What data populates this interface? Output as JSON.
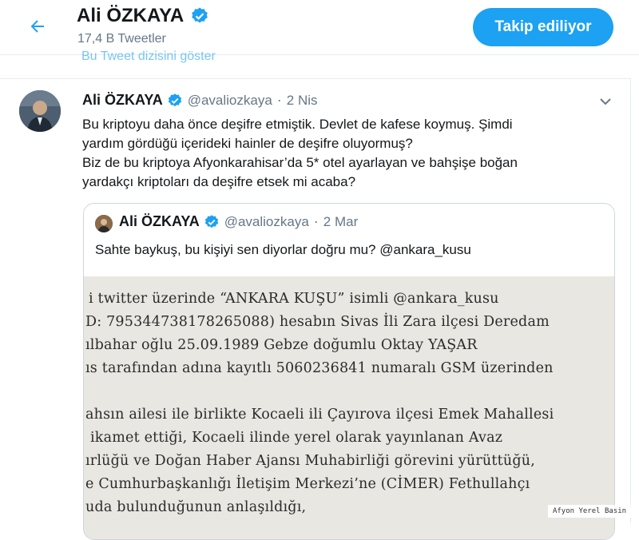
{
  "header": {
    "name": "Ali ÖZKAYA",
    "tweet_count": "17,4 B Tweetler",
    "follow_label": "Takip ediliyor",
    "show_thread": "Bu Tweet dizisini göster"
  },
  "tweet": {
    "name": "Ali ÖZKAYA",
    "handle": "@avaliozkaya",
    "separator": "·",
    "date": "2 Nis",
    "lines": [
      "Bu kriptoyu daha önce deşifre etmiştik. Devlet de kafese koymuş. Şimdi",
      "yardım gördüğü içerideki hainler de deşifre oluyormuş?",
      "Biz de bu kriptoya Afyonkarahisar’da 5* otel ayarlayan ve bahşişe boğan",
      "yardakçı kriptoları da deşifre etsek mi acaba?"
    ]
  },
  "quote": {
    "name": "Ali ÖZKAYA",
    "handle": "@avaliozkaya",
    "separator": "·",
    "date": "2 Mar",
    "text": "Sahte baykuş, bu kişiyi sen diyorlar doğru mu? @ankara_kusu",
    "image_lines": [
      "i twitter üzerinde “ANKARA KUŞU” isimli @ankara_kusu",
      "D: 795344738178265088) hesabın Sivas İli Zara ilçesi Deredam",
      "ılbahar oğlu 25.09.1989 Gebze doğumlu Oktay YAŞAR",
      "ıs tarafından adına kayıtlı 5060236841 numaralı GSM üzerinden",
      "ahsın ailesi ile birlikte Kocaeli ili Çayırova ilçesi Emek Mahallesi",
      "ikamet ettiği, Kocaeli ilinde yerel olarak yayınlanan Avaz",
      "ırlüğü ve Doğan Haber Ajansı Muhabirliği görevini yürüttüğü,",
      "e Cumhurbaşkanlığı İletişim Merkezi’ne (CİMER) Fethullahçı",
      "uda bulunduğunun anlaşıldığı,"
    ]
  },
  "watermark": "Afyon Yerel Basin",
  "colors": {
    "accent": "#1da1f2",
    "muted": "#657786",
    "border": "#e6ecf0"
  },
  "icons": [
    "back-arrow-icon",
    "verified-badge-icon",
    "chevron-down-icon"
  ]
}
